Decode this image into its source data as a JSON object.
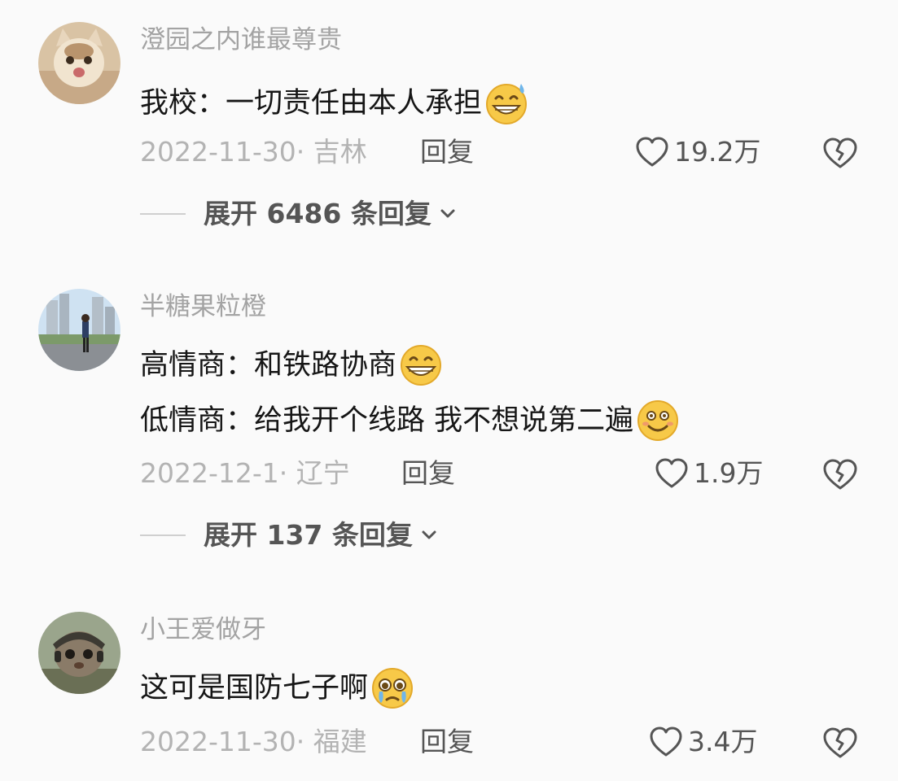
{
  "comments": [
    {
      "username": "澄园之内谁最尊贵",
      "lines": [
        "我校：一切责任由本人承担"
      ],
      "date_location": "2022-11-30· 吉林",
      "reply_label": "回复",
      "likes": "19.2万",
      "expand_label": "展开 6486 条回复",
      "emojis": [
        "grin-sweat-emoji"
      ]
    },
    {
      "username": "半糖果粒橙",
      "lines": [
        "高情商：和铁路协商",
        "低情商：给我开个线路 我不想说第二遍"
      ],
      "date_location": "2022-12-1· 辽宁",
      "reply_label": "回复",
      "likes": "1.9万",
      "expand_label": "展开 137 条回复",
      "emojis": [
        "grin-emoji",
        "smile-emoji"
      ]
    },
    {
      "username": "小王爱做牙",
      "lines": [
        "这可是国防七子啊"
      ],
      "date_location": "2022-11-30· 福建",
      "reply_label": "回复",
      "likes": "3.4万",
      "emojis": [
        "pleading-emoji"
      ]
    }
  ],
  "icons": [
    "heart-outline-icon",
    "broken-heart-icon",
    "chevron-down-icon"
  ],
  "colors": {
    "background": "#fafafa",
    "username": "#a3a3a3",
    "text": "#161616",
    "meta": "#b3b3b3",
    "action": "#555555",
    "emoji": "#f7c948"
  }
}
